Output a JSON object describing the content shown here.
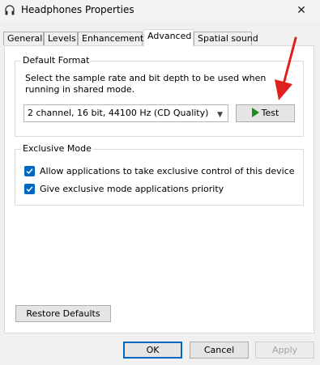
{
  "window": {
    "title": "Headphones Properties",
    "close_glyph": "✕"
  },
  "tabs": [
    {
      "label": "General",
      "active": false
    },
    {
      "label": "Levels",
      "active": false
    },
    {
      "label": "Enhancements",
      "active": false
    },
    {
      "label": "Advanced",
      "active": true
    },
    {
      "label": "Spatial sound",
      "active": false
    }
  ],
  "default_format": {
    "legend": "Default Format",
    "description": "Select the sample rate and bit depth to be used when running in shared mode.",
    "selected": "2 channel, 16 bit, 44100 Hz (CD Quality)",
    "test_label": "Test"
  },
  "exclusive_mode": {
    "legend": "Exclusive Mode",
    "options": [
      {
        "label": "Allow applications to take exclusive control of this device",
        "checked": true
      },
      {
        "label": "Give exclusive mode applications priority",
        "checked": true
      }
    ]
  },
  "buttons": {
    "restore": "Restore Defaults",
    "ok": "OK",
    "cancel": "Cancel",
    "apply": "Apply"
  },
  "colors": {
    "accent": "#0067c0",
    "arrow": "#e0201e",
    "play": "#1e8c1e"
  }
}
